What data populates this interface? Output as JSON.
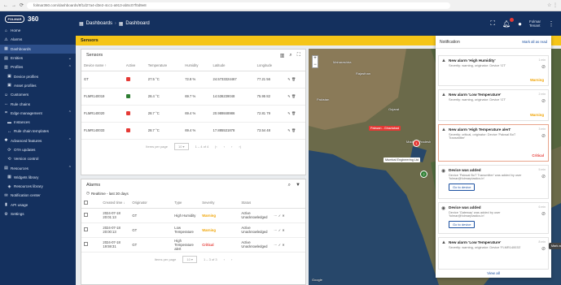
{
  "browser": {
    "url": "folmar360.com/dashboards/8f1d27a4-d3e2-4cc1-a913-ab5c07f0d9e8"
  },
  "sidebar": {
    "logo_brand": "FOLMAR",
    "logo_product": "360",
    "items": [
      {
        "label": "Home",
        "icon": "home-icon",
        "glyph": "⌂"
      },
      {
        "label": "Alarms",
        "icon": "alarm-icon",
        "glyph": "⚠"
      },
      {
        "label": "Dashboards",
        "icon": "dashboard-icon",
        "glyph": "▦"
      },
      {
        "label": "Entities",
        "icon": "entities-icon",
        "glyph": "▤"
      },
      {
        "label": "Profiles",
        "icon": "profiles-icon",
        "glyph": "▥"
      },
      {
        "label": "Device profiles",
        "icon": "device-profile-icon",
        "glyph": "▣"
      },
      {
        "label": "Asset profiles",
        "icon": "asset-profile-icon",
        "glyph": "▣"
      },
      {
        "label": "Customers",
        "icon": "customers-icon",
        "glyph": "☺"
      },
      {
        "label": "Rule chains",
        "icon": "rule-chain-icon",
        "glyph": "↔"
      },
      {
        "label": "Edge management",
        "icon": "edge-icon",
        "glyph": "⌗"
      },
      {
        "label": "Instances",
        "icon": "instances-icon",
        "glyph": "▬"
      },
      {
        "label": "Rule chain templates",
        "icon": "rule-template-icon",
        "glyph": "↔"
      },
      {
        "label": "Advanced features",
        "icon": "advanced-icon",
        "glyph": "✱"
      },
      {
        "label": "OTA updates",
        "icon": "ota-icon",
        "glyph": "⟳"
      },
      {
        "label": "Version control",
        "icon": "version-icon",
        "glyph": "⟲"
      },
      {
        "label": "Resources",
        "icon": "resources-icon",
        "glyph": "▤"
      },
      {
        "label": "Widgets library",
        "icon": "widgets-icon",
        "glyph": "▦"
      },
      {
        "label": "Resources library",
        "icon": "resource-lib-icon",
        "glyph": "◈"
      },
      {
        "label": "Notification center",
        "icon": "notification-center-icon",
        "glyph": "✉"
      },
      {
        "label": "API usage",
        "icon": "api-icon",
        "glyph": "▮"
      },
      {
        "label": "Settings",
        "icon": "settings-icon",
        "glyph": "⚙"
      }
    ]
  },
  "appbar": {
    "breadcrumb_1": "Dashboards",
    "breadcrumb_2": "Dashboard",
    "user_name": "Folmar",
    "user_role": "Tenant"
  },
  "dashboard_title": "Sensors",
  "devices": {
    "title": "Sensors",
    "columns": [
      "Device name ↑",
      "Active",
      "Temperature",
      "Humidity",
      "Latitude",
      "Longitude"
    ],
    "rows": [
      {
        "name": "GT",
        "active": "#e53935",
        "temperature": "27.5 °C",
        "humidity": "72.8 %",
        "latitude": "24.5733324467",
        "longitude": "77.21 56"
      },
      {
        "name": "FLMR140019",
        "active": "#2e7d32",
        "temperature": "28.4 °C",
        "humidity": "69.7 %",
        "latitude": "14.536239048",
        "longitude": "75.95 82"
      },
      {
        "name": "FLMR140020",
        "active": "#e53935",
        "temperature": "28.7 °C",
        "humidity": "69.4 %",
        "latitude": "20.989848986",
        "longitude": "72.81 79"
      },
      {
        "name": "FLMR140033",
        "active": "#e53935",
        "temperature": "28.7 °C",
        "humidity": "69.4 %",
        "latitude": "17.885531878",
        "longitude": "73.54 48"
      }
    ],
    "pager": {
      "label": "Items per page",
      "size": "10",
      "range": "1 – 4 of 4"
    }
  },
  "alarms": {
    "title": "Alarms",
    "filter": "Realtime - last 30 days",
    "columns": [
      "Created time ↓",
      "Originator",
      "Type",
      "Severity",
      "Status"
    ],
    "rows": [
      {
        "time": "2024-07-18 20:01:13",
        "originator": "GT",
        "type": "High Humidity",
        "severity": "Warning",
        "severity_class": "sev-warning",
        "status": "Active Unacknowledged"
      },
      {
        "time": "2024-07-18 20:00:13",
        "originator": "GT",
        "type": "Low Temperature",
        "severity": "Warning",
        "severity_class": "sev-warning",
        "status": "Active Unacknowledged"
      },
      {
        "time": "2024-07-18 19:59:31",
        "originator": "GT",
        "type": "High Temperature alert",
        "severity": "Critical",
        "severity_class": "sev-critical",
        "status": "Active Unacknowledged"
      }
    ],
    "pager": {
      "label": "Items per page",
      "size": "10",
      "range": "1 – 3 of 3"
    }
  },
  "map": {
    "labels": [
      "Rajasthan",
      "Gujarat",
      "Madhya Pradesh",
      "Maharashtra",
      "Pakistan"
    ],
    "tag_1": "Pakwan - Ghaziabad",
    "tag_2": "Mumbai Engineering Ltd",
    "marker_1": "1",
    "marker_2": "2",
    "attribution": "Google"
  },
  "notifications": {
    "title": "Notification",
    "mark_all": "Mark all as read",
    "view_all": "View all",
    "tooltip": "Mark as read",
    "items": [
      {
        "title": "New alarm 'High Humidity'",
        "text": "Severity: warning, originator: Device 'GT'",
        "time": "1 min",
        "severity": "Warning",
        "severity_color": "#f0a300",
        "highlight": false
      },
      {
        "title": "New alarm 'Low Temperature'",
        "text": "Severity: warning, originator: Device 'GT'",
        "time": "2 min",
        "severity": "Warning",
        "severity_color": "#f0a300",
        "highlight": false
      },
      {
        "title": "New alarm 'High Temperature alert'",
        "text": "Severity: critical, originator: Device 'Pakwal BoT Transmitter'",
        "time": "3 min",
        "severity": "Critical",
        "severity_color": "#e53935",
        "highlight": true
      },
      {
        "title": "Device was added",
        "text": "Device 'Pakwal BoT Transmitter' was added by user 'folmar@folmarplastics.in'",
        "time": "5 min",
        "goto": "Go to device",
        "highlight": false
      },
      {
        "title": "Device was added",
        "text": "Device 'Gateway' was added by user 'folmar@folmarplastics.in'",
        "time": "6 min",
        "goto": "Go to device",
        "highlight": false
      },
      {
        "title": "New alarm 'Low Temperature'",
        "text": "Severity: warning, originator: Device 'FLMR140033'",
        "time": "8 min",
        "severity": "",
        "severity_color": "#f0a300",
        "highlight": false
      }
    ]
  },
  "colors": {
    "sidebar": "#14305e",
    "accent": "#f5c518",
    "critical": "#e53935",
    "warning": "#f0a300",
    "active_green": "#2e7d32"
  }
}
